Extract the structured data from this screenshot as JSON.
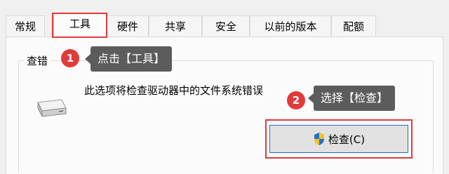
{
  "tabs": [
    {
      "label": "常规",
      "active": false
    },
    {
      "label": "工具",
      "active": true
    },
    {
      "label": "硬件",
      "active": false
    },
    {
      "label": "共享",
      "active": false
    },
    {
      "label": "安全",
      "active": false
    },
    {
      "label": "以前的版本",
      "active": false
    },
    {
      "label": "配额",
      "active": false
    }
  ],
  "group": {
    "title": "查错",
    "description": "此选项将检查驱动器中的文件系统错误",
    "button_label": "检查(C)",
    "button_icon": "uac-shield-icon"
  },
  "annotations": [
    {
      "number": "1",
      "text": "点击【工具】"
    },
    {
      "number": "2",
      "text": "选择【检查】"
    }
  ],
  "colors": {
    "highlight": "#e23a3a",
    "tooltip_bg": "#5c5c5c",
    "button_border": "#1f6fd1"
  }
}
